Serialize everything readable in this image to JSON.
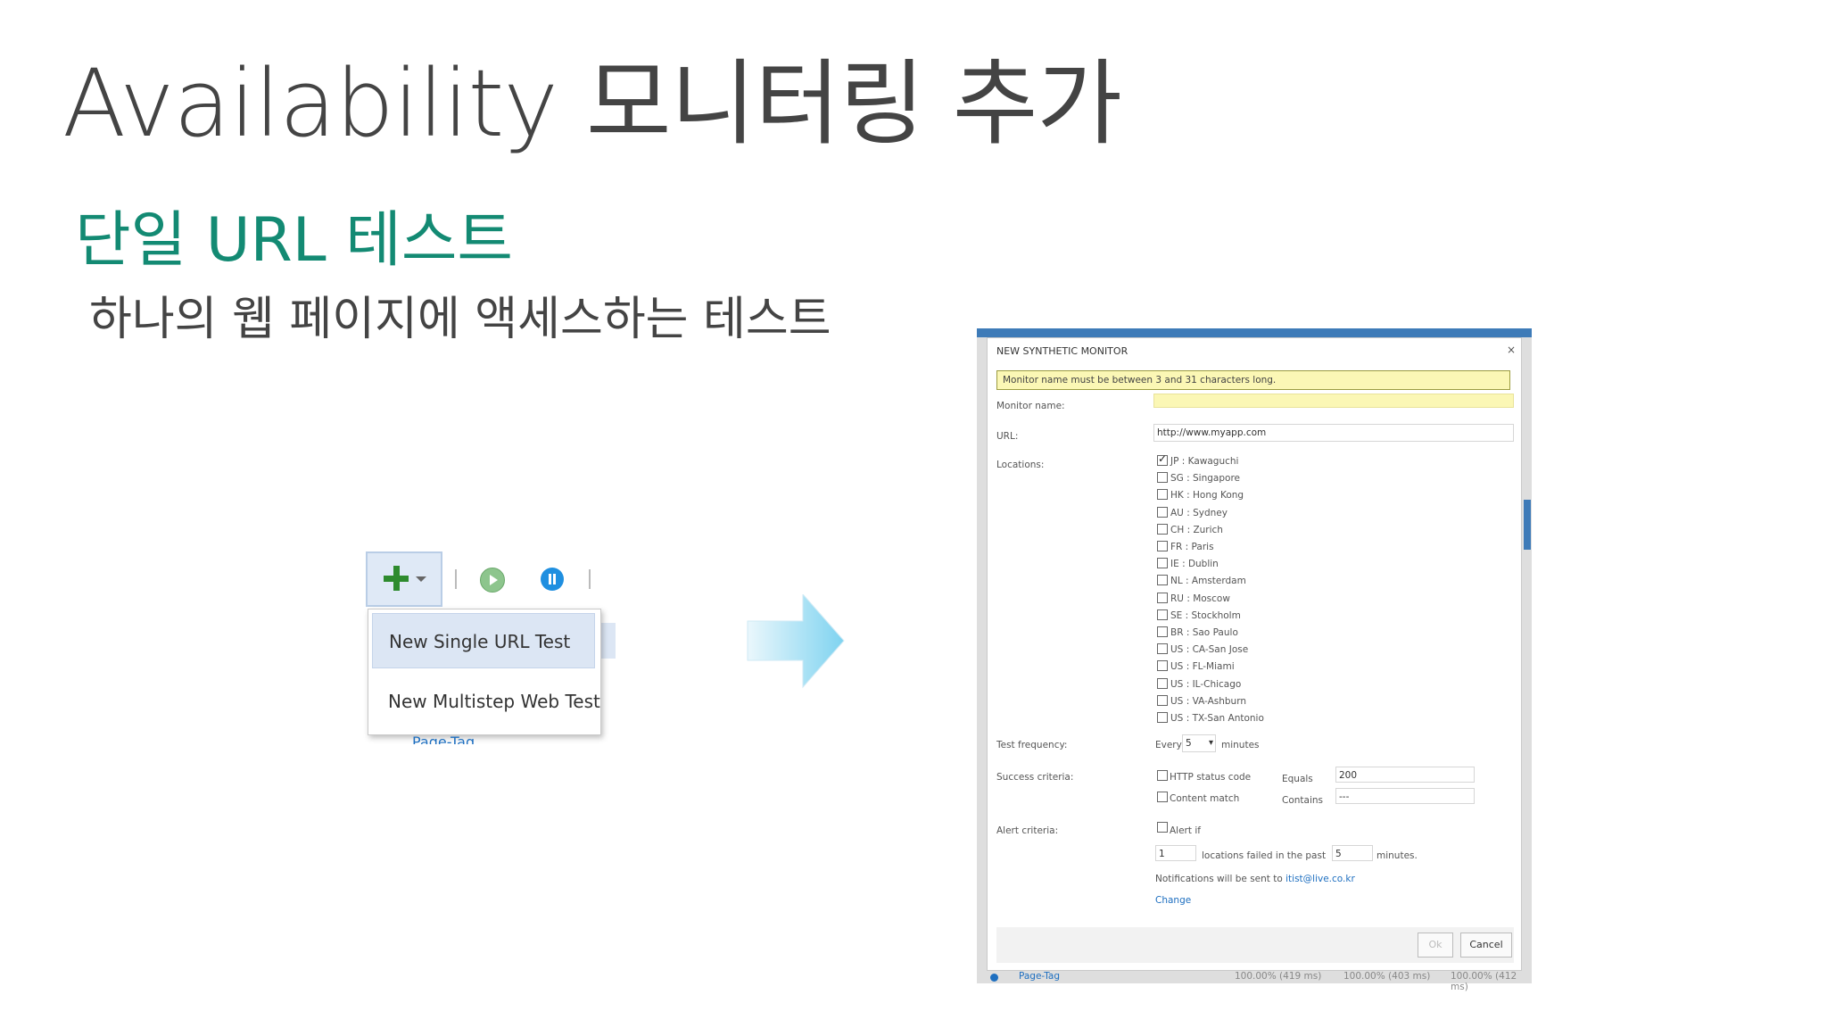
{
  "slide": {
    "title": "Availability 모니터링 추가",
    "subtitle": "단일 URL 테스트",
    "description": "하나의 웹 페이지에 액세스하는 테스트"
  },
  "menu": {
    "items": [
      "New Single URL Test",
      "New Multistep Web Test"
    ],
    "cut_text": "Page-Tag"
  },
  "dialog": {
    "title": "NEW SYNTHETIC MONITOR",
    "close": "×",
    "warning": "Monitor name must be between 3 and 31 characters long.",
    "monitor_name_label": "Monitor name:",
    "monitor_name_value": "",
    "url_label": "URL:",
    "url_value": "http://www.myapp.com",
    "locations_label": "Locations:",
    "locations": [
      {
        "label": "JP : Kawaguchi",
        "checked": true
      },
      {
        "label": "SG : Singapore",
        "checked": false
      },
      {
        "label": "HK : Hong Kong",
        "checked": false
      },
      {
        "label": "AU : Sydney",
        "checked": false
      },
      {
        "label": "CH : Zurich",
        "checked": false
      },
      {
        "label": "FR : Paris",
        "checked": false
      },
      {
        "label": "IE : Dublin",
        "checked": false
      },
      {
        "label": "NL : Amsterdam",
        "checked": false
      },
      {
        "label": "RU : Moscow",
        "checked": false
      },
      {
        "label": "SE : Stockholm",
        "checked": false
      },
      {
        "label": "BR : Sao Paulo",
        "checked": false
      },
      {
        "label": "US : CA-San Jose",
        "checked": false
      },
      {
        "label": "US : FL-Miami",
        "checked": false
      },
      {
        "label": "US : IL-Chicago",
        "checked": false
      },
      {
        "label": "US : VA-Ashburn",
        "checked": false
      },
      {
        "label": "US : TX-San Antonio",
        "checked": false
      }
    ],
    "frequency_label": "Test frequency:",
    "every": "Every",
    "frequency_value": "5",
    "minutes": "minutes",
    "success_label": "Success criteria:",
    "http_status": "HTTP status code",
    "equals": "Equals",
    "equals_value": "200",
    "content_match": "Content match",
    "contains": "Contains",
    "contains_value": "---",
    "alert_label": "Alert criteria:",
    "alert_if": "Alert if",
    "alert_count": "1",
    "locations_failed": "locations failed in the past",
    "alert_minutes_value": "5",
    "alert_minutes": "minutes.",
    "notifications_prefix": "Notifications will be sent to",
    "email": "itist@live.co.kr",
    "change": "Change",
    "ok": "Ok",
    "cancel": "Cancel"
  },
  "status_row": {
    "name": "Page-Tag",
    "values": [
      "100.00% (419 ms)",
      "100.00% (403 ms)",
      "100.00% (412 ms)"
    ]
  }
}
